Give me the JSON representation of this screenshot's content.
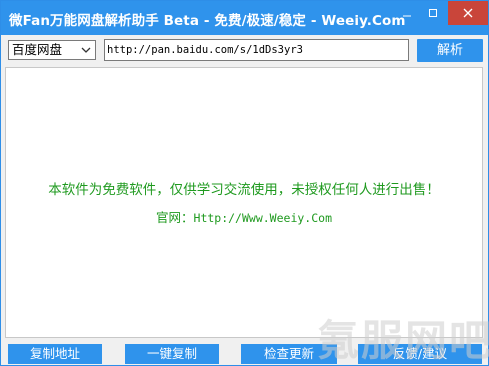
{
  "window": {
    "title": "微Fan万能网盘解析助手 Beta - 免费/极速/稳定 - Weeiy.Com"
  },
  "toolbar": {
    "disk_select_value": "百度网盘",
    "url_value": "http://pan.baidu.com/s/1dDs3yr3",
    "parse_label": "解析"
  },
  "content": {
    "notice": "本软件为免费软件，仅供学习交流使用，未授权任何人进行出售！",
    "site_label": "官网：",
    "site_url": "Http://Www.Weeiy.Com"
  },
  "buttons": {
    "copy_address": "复制地址",
    "one_click_copy": "一键复制",
    "check_update": "检查更新",
    "feedback": "反馈/建议"
  },
  "watermark": {
    "text": "氪服网吧"
  },
  "colors": {
    "accent": "#2f93ec",
    "notice_green": "#1f9a1f",
    "close_red": "#c9453a"
  }
}
